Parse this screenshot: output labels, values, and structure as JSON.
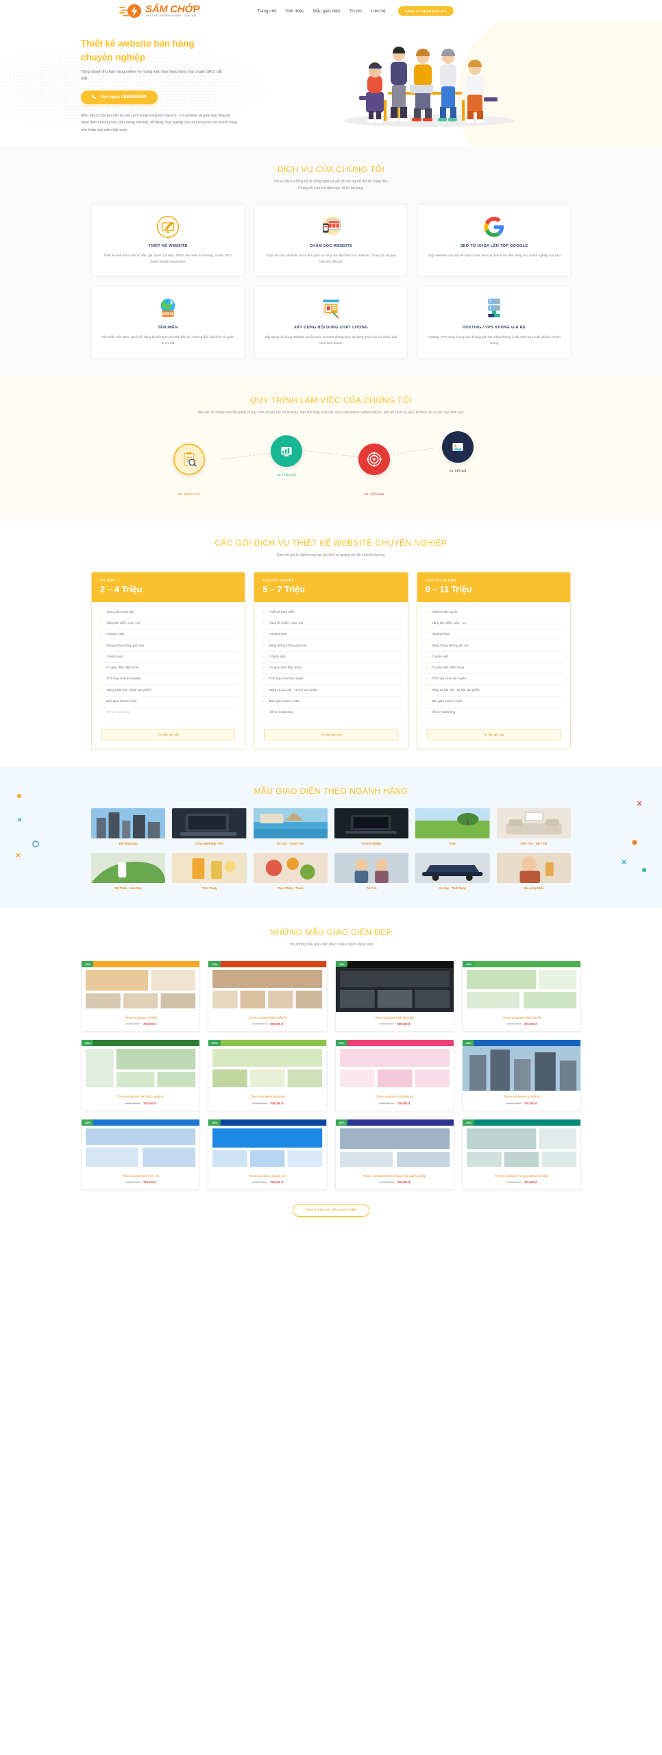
{
  "brand": {
    "name": "SẤM CHỚP",
    "tagline": "THIẾT KẾ CHUYÊN NGHIỆP - TẬN TÂM",
    "accent": "#f07c1e",
    "primary": "#fbc02d"
  },
  "nav": {
    "items": [
      {
        "label": "Trang chủ"
      },
      {
        "label": "Giới thiệu"
      },
      {
        "label": "Mẫu giao diện"
      },
      {
        "label": "Tin tức"
      },
      {
        "label": "Liên hệ"
      }
    ],
    "cta": "ĐĂNG KÝ NHẬN BÁO GIÁ"
  },
  "hero": {
    "title_line1": "Thiết kế website bán hàng",
    "title_line2": "chuyên nghiệp",
    "subtitle": "Tăng doanh thu bán hàng online với trang web bán hàng được lập chuẩn SEO, bắt mắt",
    "cta": "Gọi ngay 0999999999",
    "phone_icon": "phone-icon",
    "body": "Nắm bắt cơ hội tạo nên lợi thế cạnh tranh trong thời đại 4.0 . Có website sẽ giúp bạn tăng độ nhận diện thương hiệu trên mạng internet, dễ dàng chạy quảng cáo và tương tác với khách hàng trên khắp mọi miền đất nước"
  },
  "services": {
    "title": "DỊCH VỤ CỦA CHÚNG TÔI",
    "desc_line1": "Với sự đầu tư đồng bộ về công nghệ và yếu tố con người đặt lên hàng đầu.",
    "desc_line2": "Chúng tôi cam kết đảm bảo 100% hài lòng.",
    "items": [
      {
        "icon": "monitor-pencil-icon",
        "name": "THIẾT KẾ WEBSITE",
        "text": "Thiết kế web theo mẫu có sẵn, giá chỉ từ 1,9 triệu. TẶNG tên miền và hosting, chuẩn SEO, chuẩn mobile responsive."
      },
      {
        "icon": "responsive-devices-icon",
        "name": "CHĂM SÓC WEBSITE",
        "text": "Giúp các bạn tiết kiệm được thời gian và công sức để chăm sóc website. Chúng tôi sẽ giúp bạn làm điều đó"
      },
      {
        "icon": "google-icon",
        "name": "SEO TỪ KHÓA LÊN TOP GOOGLE",
        "text": "Giúp Website của bạn lên Top Goole, đem lại doanh thu bền vững cho doanh nghiệp của bạn"
      },
      {
        "icon": "globe-www-icon",
        "name": "TÊN MIỀN",
        "text": "Tên miền Việt Nam, Quốc tế, đăng ký thông tin chủ thể đầy đủ. Hướng dẫn cấu hình và quản trị chi tiết"
      },
      {
        "icon": "content-page-icon",
        "name": "XÂY DỰNG NỘI DUNG CHẤT LƯỢNG",
        "text": "Xây dựng nội dung Website chuẩn Seo, Content phong phú, đa dạng, phù hợp với nhiều loại hình kinh doanh"
      },
      {
        "icon": "server-rack-icon",
        "name": "HOSTING / VPS KHỦNG GIÁ RẺ",
        "text": "Hosting, VPS dung lượng cao, không giới hạn băng thông, ổ đĩa SSD truy xuất dữ liệu nhanh chóng"
      }
    ]
  },
  "process": {
    "title": "QUY TRÌNH LÀM VIỆC CỦA CHÚNG TÔI",
    "desc": "Mọi việc B Design làm đều phải có quy trình chuẩn xác và an toàn, hạn chế thấp nhất các rủi ro cho doanh nghiệp đầu tư. Đối với Dịch vụ SEO UPtech sẽ có các quy trình sau:",
    "steps": [
      {
        "num": "01.",
        "label": "Nghiên cứu",
        "icon": "research-clipboard-icon",
        "color": "#fbc02d"
      },
      {
        "num": "02.",
        "label": "Phân tích",
        "icon": "analysis-icon",
        "color": "#17b794"
      },
      {
        "num": "03.",
        "label": "Triển khai",
        "icon": "target-icon",
        "color": "#e53935"
      },
      {
        "num": "04.",
        "label": "Kết quả",
        "icon": "result-image-icon",
        "color": "#1f2b4d"
      }
    ]
  },
  "pricing": {
    "title": "CÁC GÓI DỊCH VỤ THIẾT KẾ WEBSITE CHUYÊN NGHIỆP",
    "desc": "Cam kết giá & chất lượng các gói dịch vụ quảng cáo tốt nhất thị trường.",
    "packages": [
      {
        "tier": "CƠ BẢN",
        "price": "2 – 4 Triệu",
        "cta": "Tư vấn gói này",
        "features": [
          "Theo mẫu chọn sẵn",
          "Tặng tên miền .com .net",
          "Hosting 1GB",
          "Băng thông không giới hạn",
          "1 Ngôn ngữ",
          "Có giao diện điện thoại",
          "Tích hợp chat trực tuyến",
          "Tặng 5 bài viết - 5 bài sản phẩm",
          "Bàn giao source code",
          "Hỗ trợ marketing"
        ]
      },
      {
        "tier": "CHUYÊN NGHIỆP",
        "price": "5 – 7 Triệu",
        "cta": "Tư vấn gói này",
        "features": [
          "Thiết kế theo mẫu",
          "Tặng tên miền .com .net",
          "Hosting 5GB",
          "Băng thông không giới hạn",
          "2 Ngôn ngữ",
          "Có giao diện điện thoại",
          "Tích hợp chat trực tuyến",
          "Tặng 10 bài viết - 10 bài sản phẩm",
          "Bàn giao source code",
          "Hỗ trợ marketing"
        ]
      },
      {
        "tier": "CHUYÊN NGHIỆP",
        "price": "9 – 11 Triệu",
        "cta": "Tư vấn gói này",
        "features": [
          "Thiết kế độc quyền",
          "Tặng tên miền .com , .vn",
          "Hosting 5GB",
          "Băng thông không giới hạn",
          "1 Ngôn ngữ",
          "Có giao diện điện thoại",
          "Tích hợp chat trực tuyến",
          "Tặng 20 bài viết - 20 bài sản phẩm",
          "Bàn giao source code",
          "Hỗ trợ marketing"
        ]
      }
    ]
  },
  "industry": {
    "title": "MẪU GIAO DIỆN THEO NGÀNH HÀNG",
    "items": [
      {
        "caption": "Bất Động Sản",
        "thumb": "city-buildings"
      },
      {
        "caption": "Công Nghệ Máy Tính",
        "thumb": "laptop-desk"
      },
      {
        "caption": "Du Lịch - Khách Sạn",
        "thumb": "resort-pool"
      },
      {
        "caption": "Doanh Nghiệp",
        "thumb": "business-laptop"
      },
      {
        "caption": "Khác",
        "thumb": "green-field"
      },
      {
        "caption": "Kiến Trúc - Nội Thất",
        "thumb": "interior-sofa"
      },
      {
        "caption": "Mỹ Phẩm - Làm Đẹp",
        "thumb": "cosmetic-leaf"
      },
      {
        "caption": "Thời Trang",
        "thumb": "fashion-drink"
      },
      {
        "caption": "Thực Phẩm - Thuốc",
        "thumb": "food-basket"
      },
      {
        "caption": "Tin Tức",
        "thumb": "news-couple"
      },
      {
        "caption": "Xe Máy - Thiết Dụng",
        "thumb": "car-sports"
      },
      {
        "caption": "Nhà uống Khác",
        "thumb": "drink-man"
      }
    ]
  },
  "templates": {
    "title": "NHỮNG MẪU GIAO DIỆN ĐẸP",
    "desc": "Top những mẫu giao diện được nhiều người dùng nhất",
    "more": "XEM THÊM CÁC MẪU GIAO DIỆN",
    "items": [
      {
        "badge": "-30%",
        "name": "Theme wordpress nội thất",
        "old": "1.000.000 đ",
        "new": "700.000 đ",
        "shot": "interior"
      },
      {
        "badge": "-10%",
        "name": "Theme wordpress bán quần áo",
        "old": "1.000.000 đ",
        "new": "900.000 đ",
        "shot": "food"
      },
      {
        "badge": "-40%",
        "name": "Theme wordpress bất động sản",
        "old": "1.000.000 đ",
        "new": "600.000 đ",
        "shot": "dark"
      },
      {
        "badge": "-30%",
        "name": "Theme wordpress nhà hàng tốt",
        "old": "1.000.000 đ",
        "new": "700.000 đ",
        "shot": "green"
      },
      {
        "badge": "-30%",
        "name": "Theme wordpress bán thuốc, quần áo",
        "old": "1.000.000 đ",
        "new": "700.000 đ",
        "shot": "pharmacy"
      },
      {
        "badge": "-30%",
        "name": "Theme wordpress nông sản",
        "old": "1.000.000 đ",
        "new": "700.000 đ",
        "shot": "farm"
      },
      {
        "badge": "-30%",
        "name": "Theme wordpress mỹ phẩm tự",
        "old": "1.000.000 đ",
        "new": "700.000 đ",
        "shot": "pink"
      },
      {
        "badge": "-30%",
        "name": "Theme wordpress cty thiết kế",
        "old": "1.000.000 đ",
        "new": "700.000 đ",
        "shot": "city"
      },
      {
        "badge": "-30%",
        "name": "Theme wordpress tin tức - Số",
        "old": "1.000.000 đ",
        "new": "700.000 đ",
        "shot": "news"
      },
      {
        "badge": "-30%",
        "name": "Theme wordpress Doanh vị trí",
        "old": "1.000.000 đ",
        "new": "700.000 đ",
        "shot": "blue"
      },
      {
        "badge": "-30%",
        "name": "Theme wordpress thiết kế trang chủ doanh nghiệp",
        "old": "1.000.000 đ",
        "new": "700.000 đ",
        "shot": "office"
      },
      {
        "badge": "-30%",
        "name": "Theme wordpress Công ty thiết kế nội thất",
        "old": "1.000.000 đ",
        "new": "700.000 đ",
        "shot": "realestate"
      }
    ]
  }
}
